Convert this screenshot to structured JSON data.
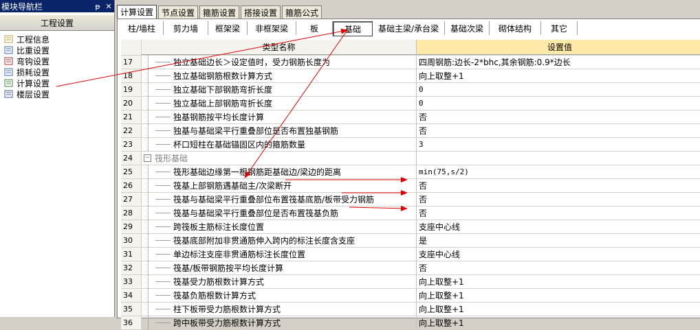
{
  "nav": {
    "title": "模块导航栏",
    "pin": "ᵽ",
    "close": "✕",
    "section": "工程设置",
    "items": [
      {
        "label": "工程信息"
      },
      {
        "label": "比重设置"
      },
      {
        "label": "弯钩设置"
      },
      {
        "label": "损耗设置"
      },
      {
        "label": "计算设置"
      },
      {
        "label": "楼层设置"
      }
    ]
  },
  "tabs": [
    "计算设置",
    "节点设置",
    "箍筋设置",
    "搭接设置",
    "箍筋公式"
  ],
  "active_tab": 0,
  "subtabs": [
    "柱/墙柱",
    "剪力墙",
    "框架梁",
    "非框架梁",
    "板",
    "基础",
    "基础主梁/承台梁",
    "基础次梁",
    "砌体结构",
    "其它"
  ],
  "active_subtab": 5,
  "grid": {
    "header_name": "类型名称",
    "header_value": "设置值",
    "rows": [
      {
        "num": "17",
        "name": "独立基础边长＞设定值时，受力钢筋长度为",
        "value": "四周钢筋:边长-2*bhc,其余钢筋:0.9*边长"
      },
      {
        "num": "18",
        "name": "独立基础钢筋根数计算方式",
        "value": "向上取整+1"
      },
      {
        "num": "19",
        "name": "独立基础下部钢筋弯折长度",
        "value": "0"
      },
      {
        "num": "20",
        "name": "独立基础上部钢筋弯折长度",
        "value": "0"
      },
      {
        "num": "21",
        "name": "独基钢筋按平均长度计算",
        "value": "否"
      },
      {
        "num": "22",
        "name": "独基与基础梁平行重叠部位是否布置独基钢筋",
        "value": "否"
      },
      {
        "num": "23",
        "name": "杯口短柱在基础锚固区内的箍筋数量",
        "value": "3"
      },
      {
        "num": "24",
        "name": "筏形基础",
        "value": "",
        "group": true,
        "expander": "−"
      },
      {
        "num": "25",
        "name": "筏形基础边缘第一根钢筋距基础边/梁边的距离",
        "value": "min(75,s/2)"
      },
      {
        "num": "26",
        "name": "筏基上部钢筋遇基础主/次梁断开",
        "value": "否"
      },
      {
        "num": "27",
        "name": "筏基与基础梁平行重叠部位布置筏基底筋/板带受力钢筋",
        "value": "否"
      },
      {
        "num": "28",
        "name": "筏基与基础梁平行重叠部位是否布置筏基负筋",
        "value": "否"
      },
      {
        "num": "29",
        "name": "跨筏板主筋标注长度位置",
        "value": "支座中心线"
      },
      {
        "num": "30",
        "name": "筏基底部附加非贯通筋伸入跨内的标注长度含支座",
        "value": "是"
      },
      {
        "num": "31",
        "name": "单边标注支座非贯通筋标注长度位置",
        "value": "支座中心线"
      },
      {
        "num": "32",
        "name": "筏基/板带钢筋按平均长度计算",
        "value": "否"
      },
      {
        "num": "33",
        "name": "筏基受力筋根数计算方式",
        "value": "向上取整+1"
      },
      {
        "num": "34",
        "name": "筏基负筋根数计算方式",
        "value": "向上取整+1"
      },
      {
        "num": "35",
        "name": "柱下板带受力筋根数计算方式",
        "value": "向上取整+1"
      },
      {
        "num": "36",
        "name": "跨中板带受力筋根数计算方式",
        "value": "向上取整+1"
      }
    ]
  },
  "colors": {
    "titlebar": "#0a246a",
    "header_value_bg": "#ffe9a8",
    "annotation": "#e00000"
  }
}
